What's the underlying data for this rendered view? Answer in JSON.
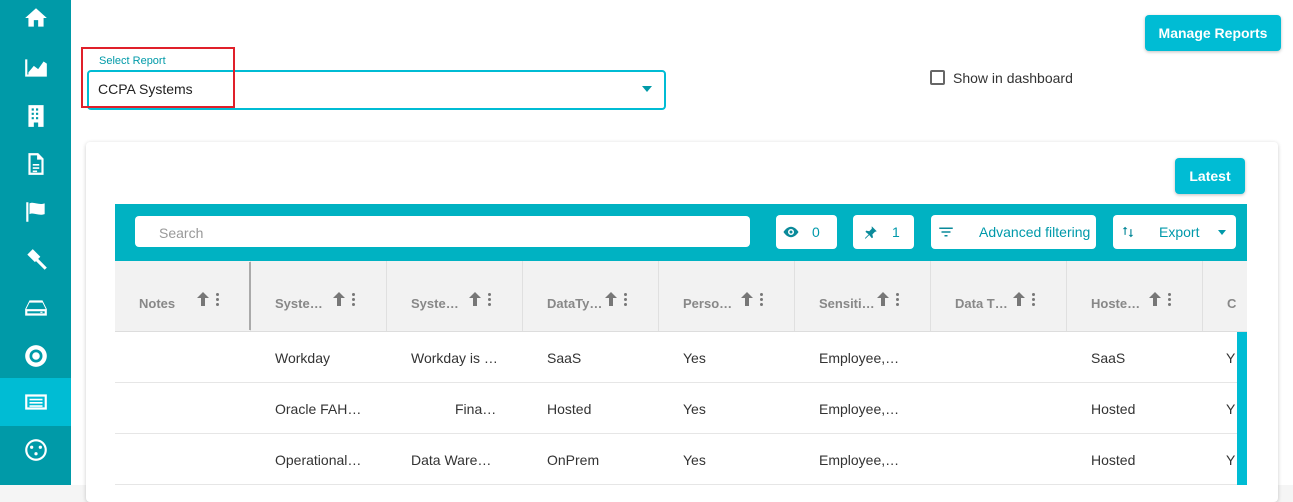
{
  "sidebar": {
    "items": [
      {
        "icon": "home-icon"
      },
      {
        "icon": "chart-icon"
      },
      {
        "icon": "building-icon"
      },
      {
        "icon": "document-icon"
      },
      {
        "icon": "flag-icon"
      },
      {
        "icon": "gavel-icon"
      },
      {
        "icon": "drive-icon"
      },
      {
        "icon": "lifebuoy-icon"
      },
      {
        "icon": "reports-icon",
        "active": true
      },
      {
        "icon": "settings-icon"
      }
    ]
  },
  "header": {
    "manage_reports": "Manage Reports",
    "select_report_label": "Select Report",
    "select_report_value": "CCPA Systems",
    "show_in_dashboard": "Show in dashboard"
  },
  "card": {
    "latest": "Latest",
    "search_placeholder": "Search",
    "visible_count": "0",
    "pinned_count": "1",
    "advanced_filtering": "Advanced filtering",
    "export": "Export"
  },
  "table": {
    "columns": [
      "Notes",
      "Syste…",
      "Syste…",
      "DataTy…",
      "Perso…",
      "Sensiti…",
      "Data T…",
      "Hoste…",
      "C"
    ],
    "rows": [
      [
        "",
        "Workday",
        "Workday is …",
        "SaaS",
        "Yes",
        "Employee,…",
        "",
        "SaaS",
        "Y"
      ],
      [
        "",
        "Oracle FAH…",
        "Fina…",
        "Hosted",
        "Yes",
        "Employee,…",
        "",
        "Hosted",
        "Y"
      ],
      [
        "",
        "Operational…",
        "Data Ware…",
        "OnPrem",
        "Yes",
        "Employee,…",
        "",
        "Hosted",
        "Y"
      ]
    ]
  },
  "colors": {
    "sidebar": "#009aa8",
    "accent": "#00bcd4",
    "highlight_box": "#e0202a"
  }
}
